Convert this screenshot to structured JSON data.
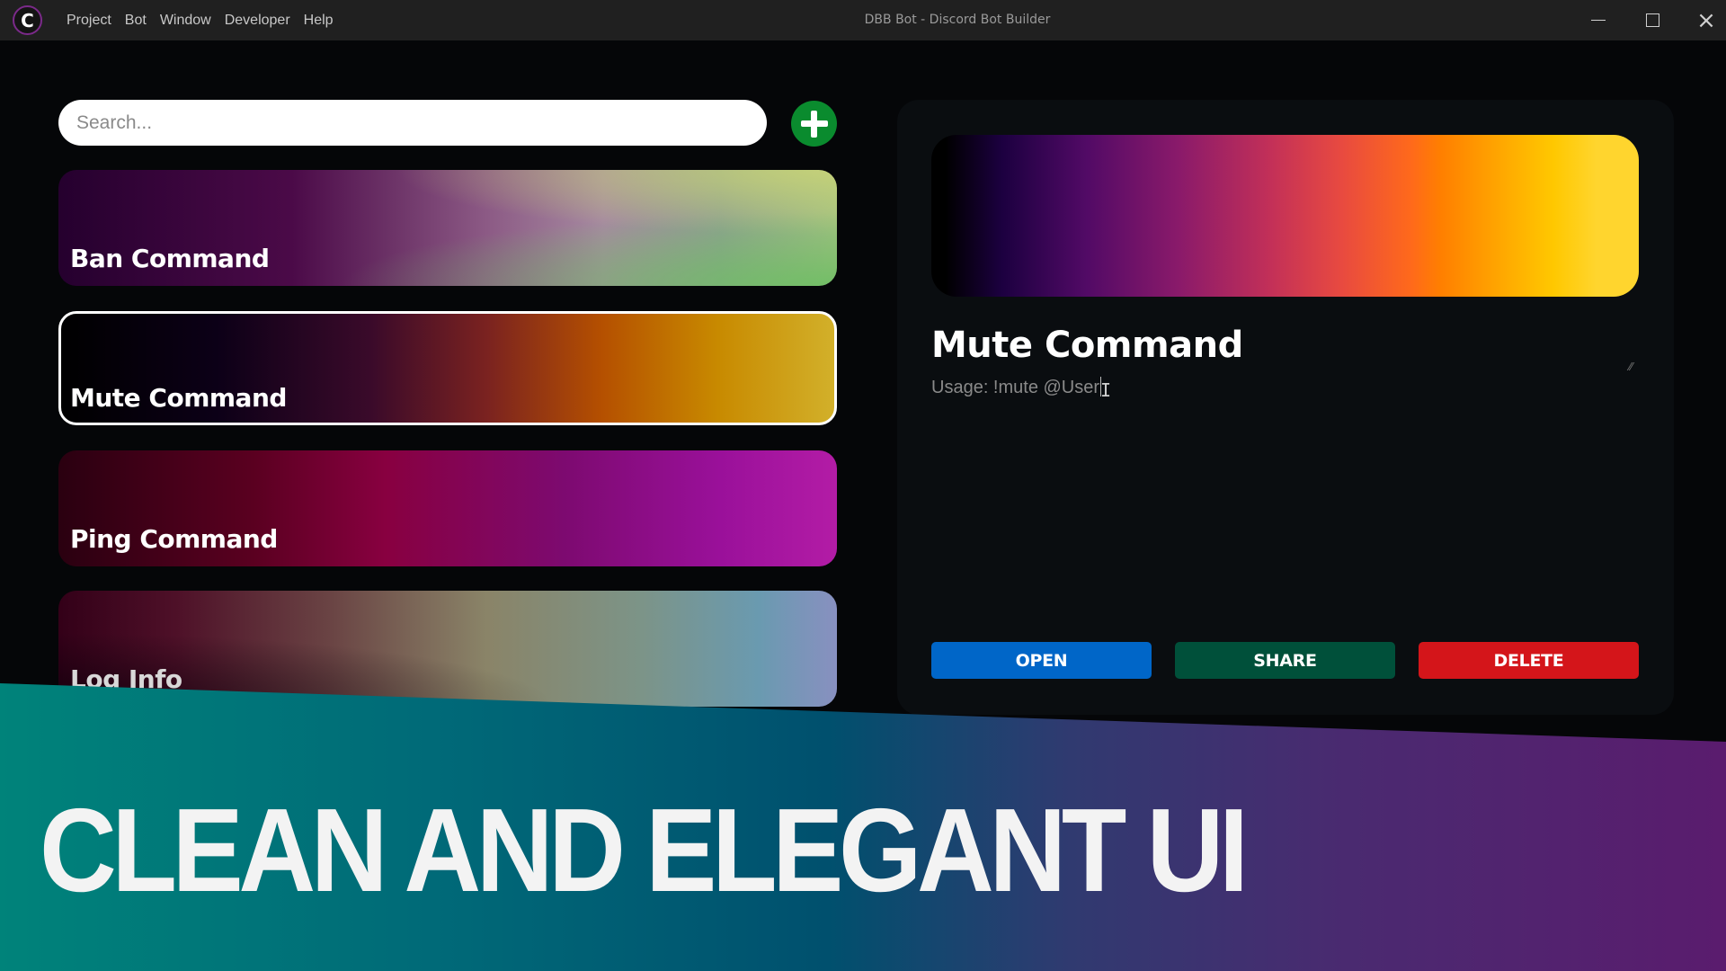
{
  "titlebar": {
    "app_logo": "C",
    "menu": [
      "Project",
      "Bot",
      "Window",
      "Developer",
      "Help"
    ],
    "title": "DBB Bot - Discord Bot Builder",
    "controls": {
      "minimize": "minimize-icon",
      "maximize": "maximize-icon",
      "close": "×"
    }
  },
  "sidebar": {
    "search": {
      "placeholder": "Search...",
      "value": ""
    },
    "add_button_icon": "plus-icon",
    "commands": [
      {
        "label": "Ban Command",
        "selected": false
      },
      {
        "label": "Mute Command",
        "selected": true
      },
      {
        "label": "Ping Command",
        "selected": false
      },
      {
        "label": "Log Info",
        "selected": false
      }
    ]
  },
  "detail": {
    "title": "Mute Command",
    "usage": "Usage: !mute @User",
    "cursor_glyph": "I",
    "resize_grip": "⁄⁄",
    "buttons": {
      "open": "OPEN",
      "share": "SHARE",
      "delete": "DELETE"
    },
    "colors": {
      "open": "#0066c8",
      "share": "#00503a",
      "delete": "#d4151a"
    }
  },
  "promo": {
    "headline": "CLEAN AND ELEGANT UI"
  }
}
